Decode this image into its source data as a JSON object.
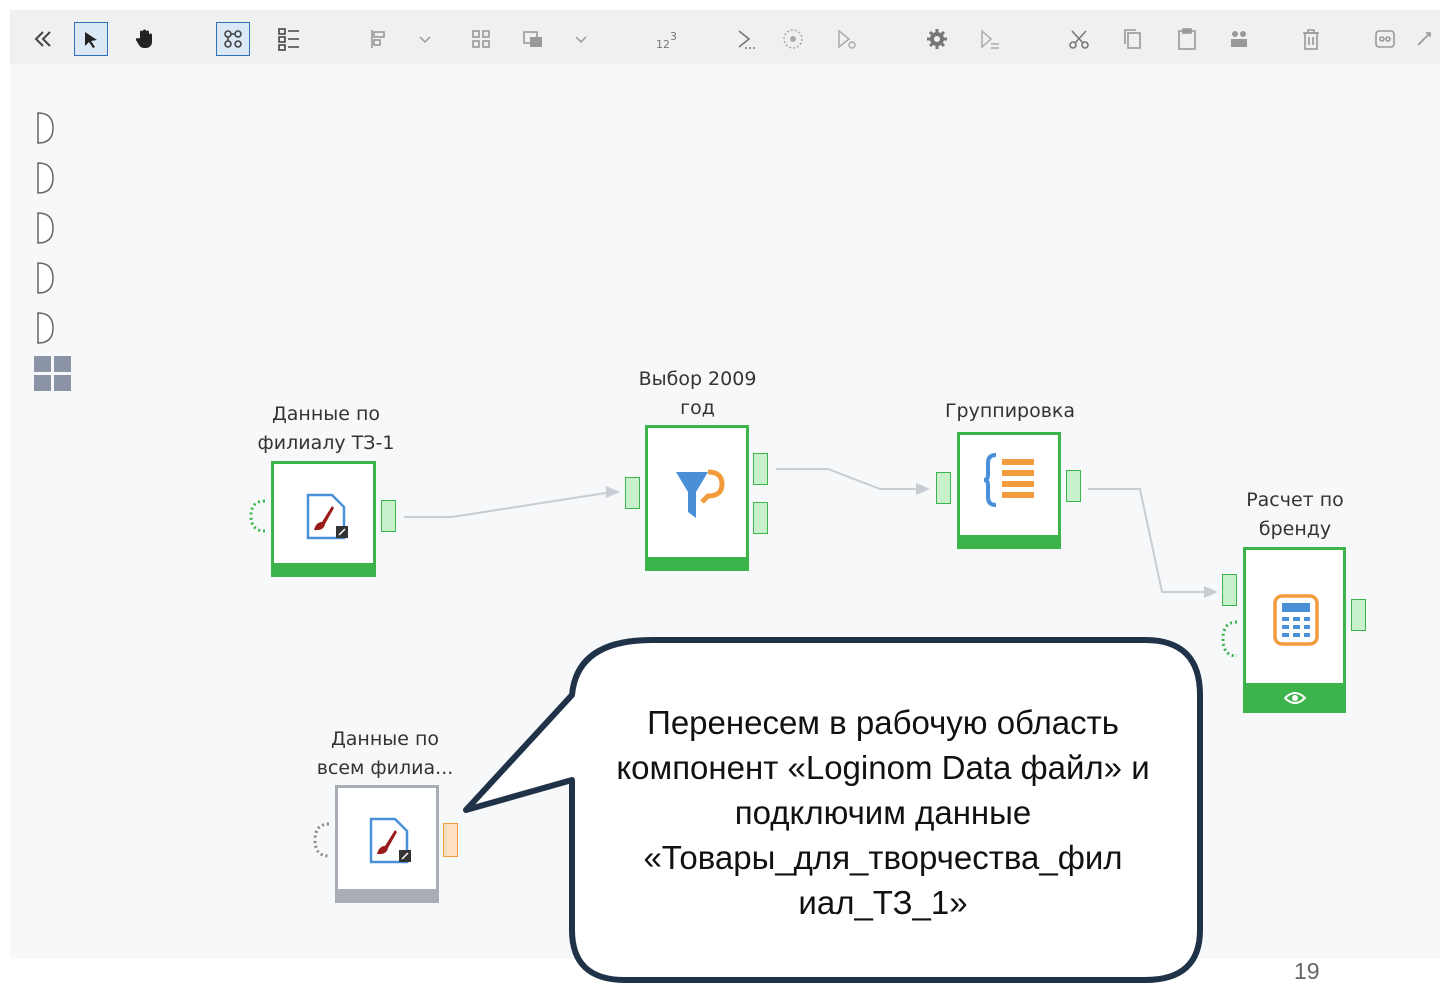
{
  "toolbar": {
    "icons": [
      "collapse-icon",
      "select-pointer-icon",
      "hand-pan-icon",
      "auto-layout-icon",
      "list-view-icon",
      "align-icon",
      "chevron-down-icon",
      "group-icon",
      "layer-icon",
      "chevron-down-icon",
      "numbering-icon",
      "run-icon",
      "stop-icon",
      "run-step-icon",
      "settings-icon",
      "run-branch-icon",
      "cut-icon",
      "copy-icon",
      "paste-icon",
      "duplicate-icon",
      "delete-icon",
      "frame-icon",
      "more-icon"
    ],
    "active": [
      "select-pointer-icon",
      "auto-layout-icon"
    ]
  },
  "nodes": {
    "data_branch": {
      "label": "Данные по\nфилиалу ТЗ-1",
      "icon": "loginom-file-icon"
    },
    "filter_2009": {
      "label": "Выбор 2009\nгод",
      "icon": "filter-funnel-icon"
    },
    "grouping": {
      "label": "Группировка",
      "icon": "grouping-icon"
    },
    "calc_brand": {
      "label": "Расчет по\nбренду",
      "icon": "calculator-icon"
    },
    "data_all": {
      "label": "Данные по\nвсем филиа...",
      "icon": "loginom-file-icon"
    }
  },
  "callout": {
    "text": "Перенесем в рабочую область компонент «Loginom Data файл» и подключим данные «Товары_для_творчества_фил иал_ТЗ_1»"
  },
  "page_number": "19",
  "colors": {
    "accent_green": "#3cb44b",
    "port_orange": "#f39c3d",
    "inactive_grey": "#a9adb8",
    "callout_border": "#1f3247",
    "funnel_blue": "#4a90d9",
    "orange": "#f39c3d"
  }
}
